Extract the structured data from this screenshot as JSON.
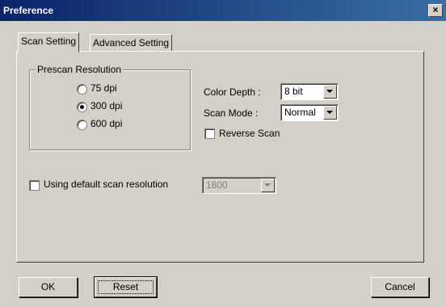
{
  "window": {
    "title": "Preference",
    "close_label": "×"
  },
  "tabs": [
    {
      "label": "Scan Setting",
      "active": true
    },
    {
      "label": "Advanced Setting",
      "active": false
    }
  ],
  "prescan": {
    "group_label": "Prescan Resolution",
    "options": [
      {
        "label": "75   dpi",
        "selected": false
      },
      {
        "label": "300 dpi",
        "selected": true
      },
      {
        "label": "600 dpi",
        "selected": false
      }
    ]
  },
  "color_depth": {
    "label": "Color Depth :",
    "value": "8 bit"
  },
  "scan_mode": {
    "label": "Scan Mode :",
    "value": "Normal"
  },
  "reverse_scan": {
    "label": "Reverse Scan",
    "checked": false
  },
  "default_resolution": {
    "label": "Using default scan resolution",
    "checked": false,
    "value": "1800",
    "disabled": true
  },
  "buttons": {
    "ok": "OK",
    "reset": "Reset",
    "cancel": "Cancel"
  }
}
